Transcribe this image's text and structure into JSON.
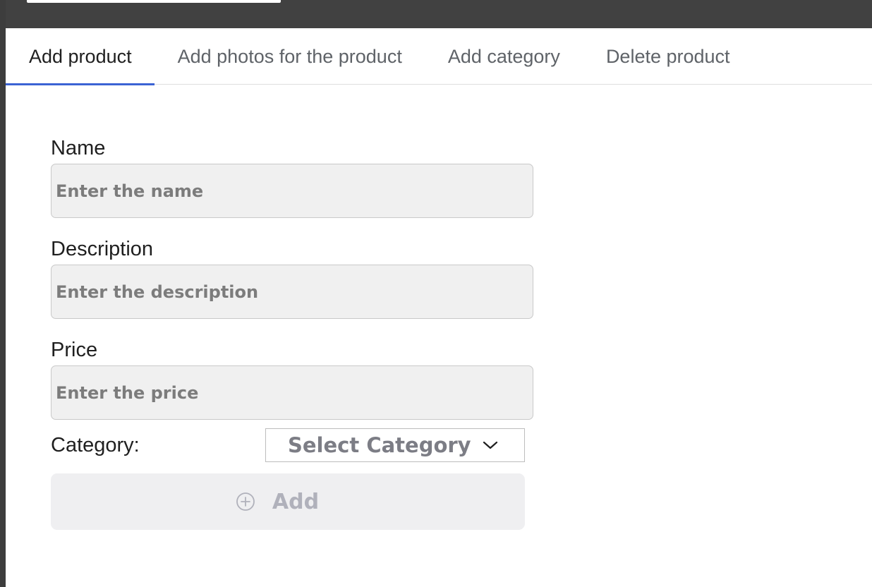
{
  "tabs": [
    {
      "label": "Add product",
      "active": true
    },
    {
      "label": "Add photos for the product",
      "active": false
    },
    {
      "label": "Add category",
      "active": false
    },
    {
      "label": "Delete product",
      "active": false
    }
  ],
  "form": {
    "name": {
      "label": "Name",
      "placeholder": "Enter the name",
      "value": ""
    },
    "description": {
      "label": "Description",
      "placeholder": "Enter the description",
      "value": ""
    },
    "price": {
      "label": "Price",
      "placeholder": "Enter the price",
      "value": ""
    },
    "category": {
      "label": "Category:",
      "selected": "Select Category",
      "icon": "chevron-down-icon"
    },
    "add_button": {
      "label": "Add",
      "icon": "plus-circle-icon"
    }
  },
  "colors": {
    "active_tab_underline": "#3b63d4",
    "topbar": "#414141"
  }
}
